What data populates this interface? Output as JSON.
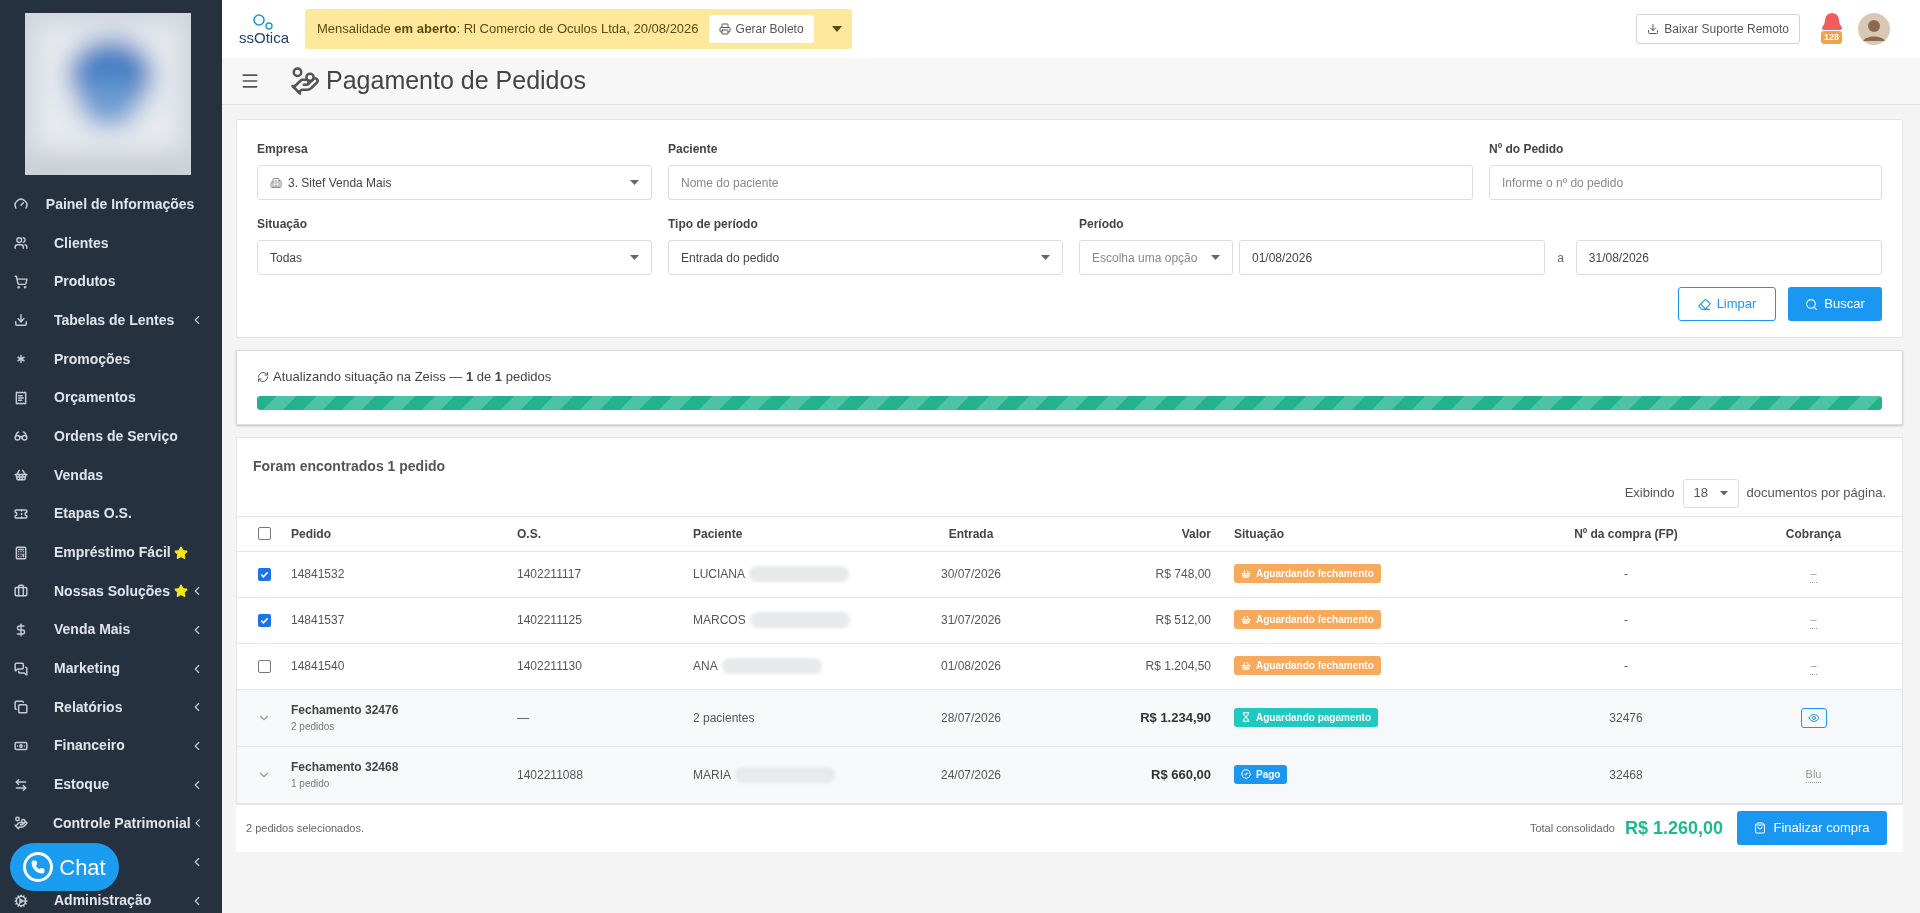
{
  "sidebar": {
    "items": [
      {
        "label": "Painel de Informações",
        "submenu": false,
        "star": false
      },
      {
        "label": "Clientes",
        "submenu": false,
        "star": false
      },
      {
        "label": "Produtos",
        "submenu": false,
        "star": false
      },
      {
        "label": "Tabelas de Lentes",
        "submenu": true,
        "star": false
      },
      {
        "label": "Promoções",
        "submenu": false,
        "star": false
      },
      {
        "label": "Orçamentos",
        "submenu": false,
        "star": false
      },
      {
        "label": "Ordens de Serviço",
        "submenu": false,
        "star": false
      },
      {
        "label": "Vendas",
        "submenu": false,
        "star": false
      },
      {
        "label": "Etapas O.S.",
        "submenu": false,
        "star": false
      },
      {
        "label": "Empréstimo Fácil",
        "submenu": false,
        "star": true
      },
      {
        "label": "Nossas Soluções",
        "submenu": true,
        "star": true
      },
      {
        "label": "Venda Mais",
        "submenu": true,
        "star": false
      },
      {
        "label": "Marketing",
        "submenu": true,
        "star": false
      },
      {
        "label": "Relatórios",
        "submenu": true,
        "star": false
      },
      {
        "label": "Financeiro",
        "submenu": true,
        "star": false
      },
      {
        "label": "Estoque",
        "submenu": true,
        "star": false
      },
      {
        "label": "Controle Patrimonial",
        "submenu": true,
        "star": false
      },
      {
        "submenu": true,
        "star": false
      },
      {
        "label": "Administração",
        "submenu": true,
        "star": false
      }
    ]
  },
  "chat_button": {
    "label": "Chat"
  },
  "topbar": {
    "logo": "ssOtica",
    "notice": {
      "prefix": "Mensalidade **em aberto**: Rl Comercio de Oculos Ltda, 20/08/2026",
      "button": "Gerar Boleto"
    },
    "support_button": "Baixar Suporte Remoto",
    "notifications": "128"
  },
  "page_title": "Pagamento de Pedidos",
  "filters": {
    "empresa": {
      "label": "Empresa",
      "value": "3. Sitef Venda Mais"
    },
    "paciente": {
      "label": "Paciente",
      "placeholder": "Nome do paciente"
    },
    "pedido": {
      "label": "Nº do Pedido",
      "placeholder": "Informe o nº do pedido"
    },
    "situacao": {
      "label": "Situação",
      "value": "Todas"
    },
    "tipo_periodo": {
      "label": "Tipo de período",
      "value": "Entrada do pedido"
    },
    "periodo": {
      "label": "Período",
      "option_placeholder": "Escolha uma opção",
      "from": "01/08/2026",
      "separator": "a",
      "to": "31/08/2026"
    },
    "buttons": {
      "clear": "Limpar",
      "search": "Buscar"
    }
  },
  "progress": {
    "text": "Atualizando situação na Zeiss — **1** de **1** pedidos",
    "level": 1
  },
  "results": {
    "title": "Foram encontrados 1 pedido",
    "page_size_prefix": "Exibindo",
    "page_size": "18",
    "page_size_suffix": "documentos por página.",
    "select_all": {
      "checked": false
    },
    "columns": [
      "Pedido",
      "O.S.",
      "Paciente",
      "Entrada",
      "Valor",
      "Situação",
      "Nº da compra (FP)",
      "Cobrança"
    ],
    "rows": [
      {
        "kind": "order",
        "checked": true,
        "pedido": "14841532",
        "os": "1402211117",
        "paciente": "LUCIANA",
        "entrada": "30/07/2026",
        "valor": "R$ 748,00",
        "status": {
          "kind": "basket",
          "label": "Aguardando fechamento",
          "color": "#f7a95c"
        },
        "compra": "-",
        "cobranca": {
          "kind": "text",
          "text": "–"
        }
      },
      {
        "kind": "order",
        "checked": true,
        "pedido": "14841537",
        "os": "1402211125",
        "paciente": "MARCOS",
        "entrada": "31/07/2026",
        "valor": "R$ 512,00",
        "status": {
          "kind": "basket",
          "label": "Aguardando fechamento",
          "color": "#f7a95c"
        },
        "compra": "-",
        "cobranca": {
          "kind": "text",
          "text": "–"
        }
      },
      {
        "kind": "order",
        "checked": false,
        "pedido": "14841540",
        "os": "1402211130",
        "paciente": "ANA",
        "entrada": "01/08/2026",
        "valor": "R$ 1.204,50",
        "status": {
          "kind": "basket",
          "label": "Aguardando fechamento",
          "color": "#f7a95c"
        },
        "compra": "-",
        "cobranca": {
          "kind": "text",
          "text": "–"
        }
      },
      {
        "kind": "closing",
        "expanded": false,
        "pedido": "Fechamento 32476",
        "sub": "2 pedidos",
        "os": "—",
        "paciente": "2 pacientes",
        "entrada": "28/07/2026",
        "valor": "R$ 1.234,90",
        "status": {
          "kind": "hourglass",
          "label": "Aguardando pagamento",
          "color": "#1fc9c1"
        },
        "compra": "32476",
        "cobranca": {
          "kind": "view"
        }
      },
      {
        "kind": "closing",
        "expanded": false,
        "pedido": "Fechamento 32468",
        "sub": "1 pedido",
        "os": "1402211088",
        "paciente": "MARIA",
        "entrada": "24/07/2026",
        "valor": "R$ 660,00",
        "status": {
          "kind": "check",
          "label": "Pago",
          "color": "#1a97f0"
        },
        "compra": "32468",
        "cobranca": {
          "kind": "text",
          "text": "Blu"
        }
      }
    ]
  },
  "footer": {
    "selected": "2 pedidos selecionados.",
    "total_label": "Total consolidado",
    "total": "R$ 1.260,00",
    "button": "Finalizar compra"
  }
}
